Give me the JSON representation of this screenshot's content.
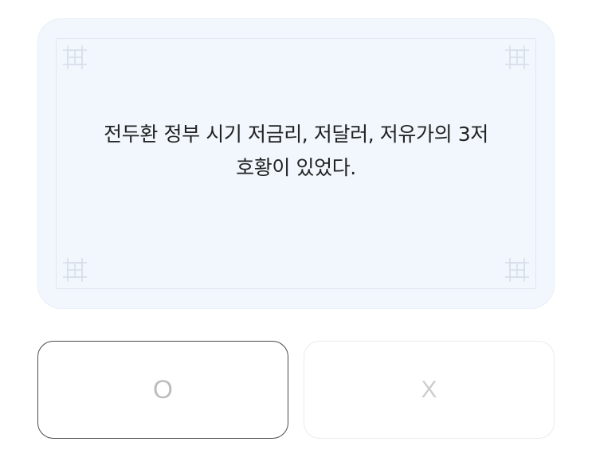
{
  "quiz": {
    "question_line_1": "전두환 정부 시기 저금리, 저달러, 저유가의 3저",
    "question_line_2": "호황이 있었다."
  },
  "answers": {
    "true_label": "O",
    "false_label": "X"
  },
  "decoration": {
    "corner_icon": "lattice-knot-icon"
  },
  "colors": {
    "card_background": "#f1f7fd",
    "frame_line": "#dfe7f0",
    "selected_border": "#4b4b4b",
    "button_border": "#e9ebee",
    "answer_text": "#c8c8c8"
  }
}
